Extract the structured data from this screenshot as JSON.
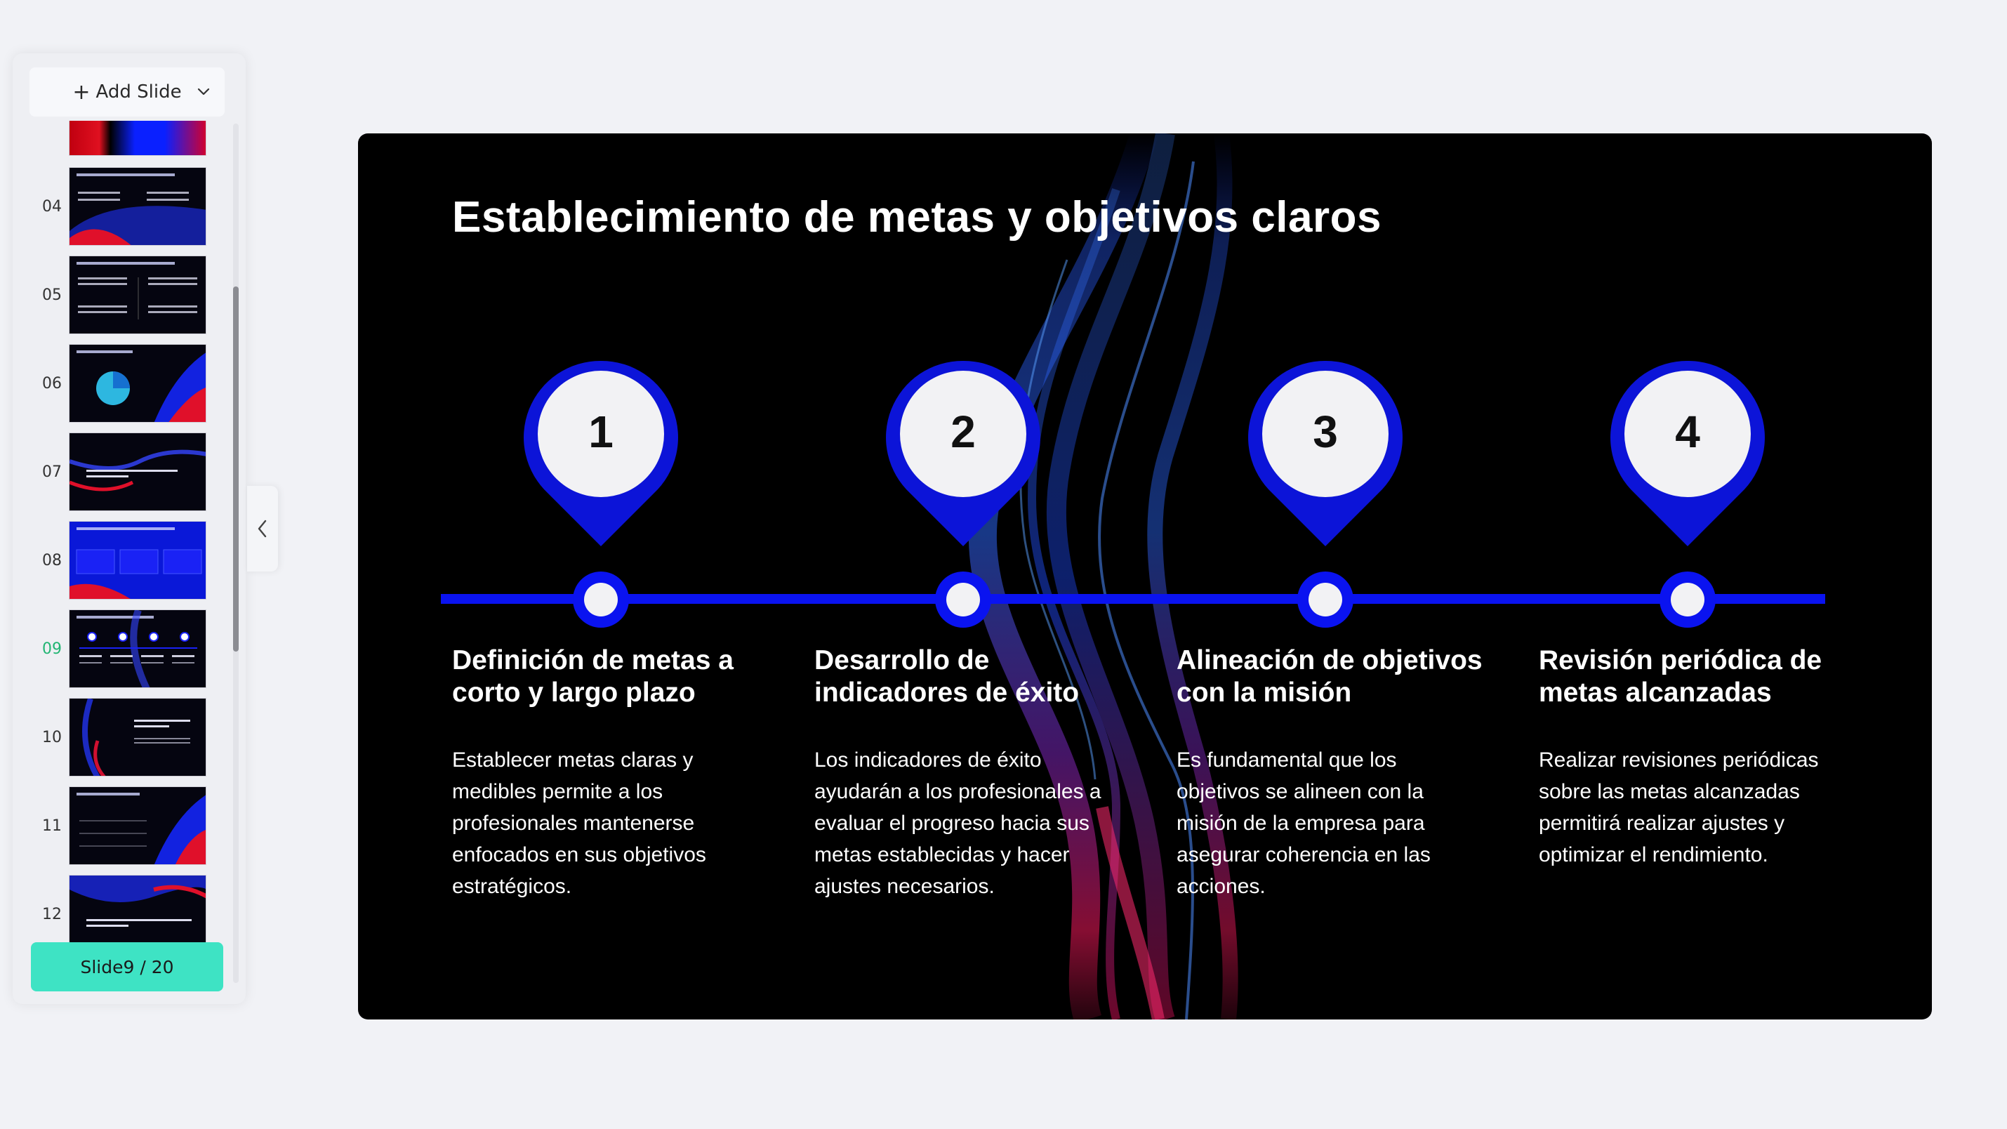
{
  "sidebar": {
    "add_slide_label": "Add Slide",
    "counter_label": "Slide9 / 20",
    "thumbnails": [
      {
        "num": "04",
        "active": false
      },
      {
        "num": "05",
        "active": false
      },
      {
        "num": "06",
        "active": false
      },
      {
        "num": "07",
        "active": false
      },
      {
        "num": "08",
        "active": false
      },
      {
        "num": "09",
        "active": true
      },
      {
        "num": "10",
        "active": false
      },
      {
        "num": "11",
        "active": false
      },
      {
        "num": "12",
        "active": false
      }
    ]
  },
  "slide": {
    "title": "Establecimiento de metas y objetivos claros",
    "steps": [
      {
        "number": "1",
        "title": "Definición de metas a corto y largo plazo",
        "body": "Establecer metas claras y medibles permite a los profesionales mantenerse enfocados en sus objetivos estratégicos."
      },
      {
        "number": "2",
        "title": "Desarrollo de indicadores de éxito",
        "body": "Los indicadores de éxito ayudarán a los profesionales a evaluar el progreso hacia sus metas establecidas y hacer ajustes necesarios."
      },
      {
        "number": "3",
        "title": "Alineación de objetivos con la misión",
        "body": "Es fundamental que los objetivos se alineen con la misión de la empresa para asegurar coherencia en las acciones."
      },
      {
        "number": "4",
        "title": "Revisión periódica de metas alcanzadas",
        "body": "Realizar revisiones periódicas sobre las metas alcanzadas permitirá realizar ajustes y optimizar el rendimiento."
      }
    ]
  },
  "colors": {
    "accent": "#0a13f0",
    "pin_outer": "#0c14d8",
    "counter_bg": "#3ee3c4",
    "active_number": "#22b573"
  }
}
